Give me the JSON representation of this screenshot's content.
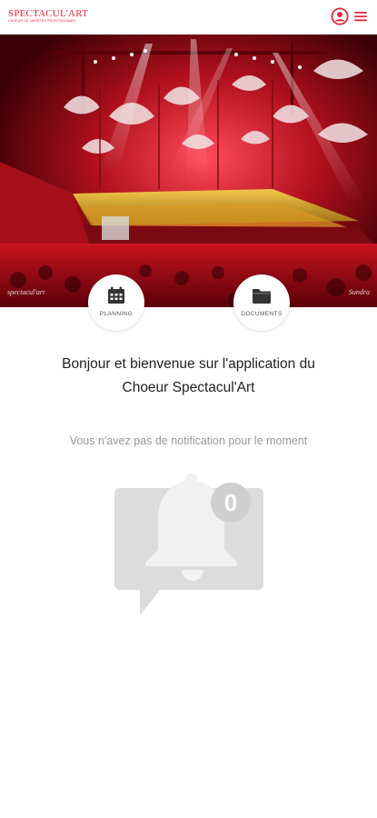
{
  "brand": {
    "name": "SPECTACUL'ART",
    "tagline": "CHOEUR DE VARIÉTÉS PROFESSIONNEL",
    "accent_color": "#e3283f"
  },
  "header": {
    "user_icon": "user-circle-icon",
    "menu_icon": "hamburger-menu-icon"
  },
  "hero": {
    "photo_subject": "concert-stage-choir",
    "watermark_left": "spectacul'art",
    "watermark_right": "Sundra"
  },
  "quick_links": [
    {
      "label": "PLANNING",
      "icon": "calendar-icon"
    },
    {
      "label": "DOCUMENTS",
      "icon": "folder-icon"
    }
  ],
  "welcome": {
    "line1": "Bonjour et bienvenue sur l'application du",
    "line2": "Choeur Spectacul'Art"
  },
  "notifications": {
    "empty_message": "Vous n'avez pas de notification pour le moment",
    "count": "0",
    "illustration_icon": "bell-notification-icon"
  }
}
